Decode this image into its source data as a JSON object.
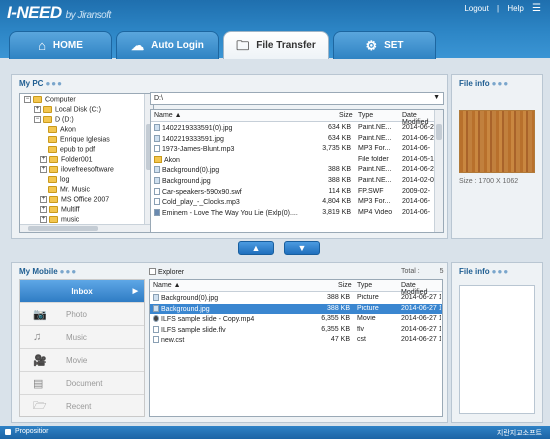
{
  "app": {
    "logo": "I-NEED",
    "by": "by Jiransoft",
    "logout": "Logout",
    "sep": "|",
    "help": "Help",
    "menu_glyph": "☰"
  },
  "tabs": [
    {
      "label": "HOME",
      "icon": "home-icon",
      "glyph": "⌂"
    },
    {
      "label": "Auto Login",
      "icon": "cloud-icon",
      "glyph": "☁"
    },
    {
      "label": "File Transfer",
      "icon": "folder-icon",
      "glyph": "🗀"
    },
    {
      "label": "SET",
      "icon": "gear-icon",
      "glyph": "⚙"
    }
  ],
  "mypc": {
    "title": "My PC",
    "path": "D:\\",
    "tree": [
      {
        "label": "Computer",
        "exp": "−"
      },
      {
        "label": "Local Disk (C:)",
        "exp": "+"
      },
      {
        "label": "D (D:)",
        "exp": "−"
      },
      {
        "label": "Akon",
        "exp": ""
      },
      {
        "label": "Enrique Iglesias",
        "exp": ""
      },
      {
        "label": "epub to pdf",
        "exp": ""
      },
      {
        "label": "Folder001",
        "exp": "+"
      },
      {
        "label": "ilovefreesoftware",
        "exp": "+"
      },
      {
        "label": "log",
        "exp": ""
      },
      {
        "label": "Mr. Music",
        "exp": ""
      },
      {
        "label": "MS Office 2007",
        "exp": "+"
      },
      {
        "label": "Multiff",
        "exp": "+"
      },
      {
        "label": "music",
        "exp": "+"
      }
    ],
    "columns": {
      "name": "Name ▲",
      "size": "Size",
      "type": "Type",
      "date": "Date Modified"
    },
    "files": [
      {
        "name": "1402219333591(0).jpg",
        "size": "634 KB",
        "type": "Paint.NE...",
        "date": "2014-06-2",
        "icon": "img"
      },
      {
        "name": "1402219333591.jpg",
        "size": "634 KB",
        "type": "Paint.NE...",
        "date": "2014-06-2",
        "icon": "img"
      },
      {
        "name": "1973-James-Blunt.mp3",
        "size": "3,735 KB",
        "type": "MP3 For...",
        "date": "2014-06-",
        "icon": "doc"
      },
      {
        "name": "Akon",
        "size": "",
        "type": "File folder",
        "date": "2014-05-1",
        "icon": "fo"
      },
      {
        "name": "Background(0).jpg",
        "size": "388 KB",
        "type": "Paint.NE...",
        "date": "2014-06-2",
        "icon": "img"
      },
      {
        "name": "Background.jpg",
        "size": "388 KB",
        "type": "Paint.NE...",
        "date": "2014-02-0",
        "icon": "img"
      },
      {
        "name": "Car-speakers-590x90.swf",
        "size": "114 KB",
        "type": "FP.SWF",
        "date": "2009-02-",
        "icon": "doc"
      },
      {
        "name": "Cold_play_-_Clocks.mp3",
        "size": "4,804 KB",
        "type": "MP3 For...",
        "date": "2014-06-",
        "icon": "doc"
      },
      {
        "name": "Eminem - Love The Way You Lie (Exlp(0)....",
        "size": "3,819 KB",
        "type": "MP4 Video",
        "date": "2014-06-",
        "icon": "vid"
      }
    ]
  },
  "fileinfo_top": {
    "title": "File info",
    "size_text": "Size : 1700 X 1062"
  },
  "transfer": {
    "up": "▲",
    "down": "▼"
  },
  "mymobile": {
    "title": "My Mobile",
    "explorer_label": "Explorer",
    "total_label": "Total :",
    "total_value": "5",
    "columns": {
      "name": "Name ▲",
      "size": "Size",
      "type": "Type",
      "date": "Date Modified"
    },
    "files": [
      {
        "name": "Background(0).jpg",
        "size": "388 KB",
        "type": "Picture",
        "date": "2014-06-27 1",
        "icon": "img",
        "selected": false
      },
      {
        "name": "Background.jpg",
        "size": "388 KB",
        "type": "Picture",
        "date": "2014-06-27 1",
        "icon": "img",
        "selected": true
      },
      {
        "name": "ILFS sample slide - Copy.mp4",
        "size": "6,355 KB",
        "type": "Movie",
        "date": "2014-06-27 1",
        "icon": "mv",
        "selected": false
      },
      {
        "name": "ILFS sample slide.flv",
        "size": "6,355 KB",
        "type": "flv",
        "date": "2014-06-27 1",
        "icon": "doc",
        "selected": false
      },
      {
        "name": "new.cst",
        "size": "47 KB",
        "type": "cst",
        "date": "2014-06-27 1",
        "icon": "doc",
        "selected": false
      }
    ],
    "sidebar": [
      {
        "label": "Inbox",
        "icon": "inbox",
        "glyph": ""
      },
      {
        "label": "Photo",
        "icon": "camera-icon",
        "glyph": "📷"
      },
      {
        "label": "Music",
        "icon": "music-icon",
        "glyph": "♫"
      },
      {
        "label": "Movie",
        "icon": "film-icon",
        "glyph": "🎥"
      },
      {
        "label": "Document",
        "icon": "document-icon",
        "glyph": "▤"
      },
      {
        "label": "Recent",
        "icon": "folder-icon",
        "glyph": "🗁"
      }
    ]
  },
  "fileinfo_bottom": {
    "title": "File info"
  },
  "footer": {
    "left": "Propositior",
    "right": "지란지교소프트"
  },
  "colors": {
    "accent": "#2d86c6",
    "selection": "#3a86d0",
    "panel_title": "#1f5e92"
  }
}
